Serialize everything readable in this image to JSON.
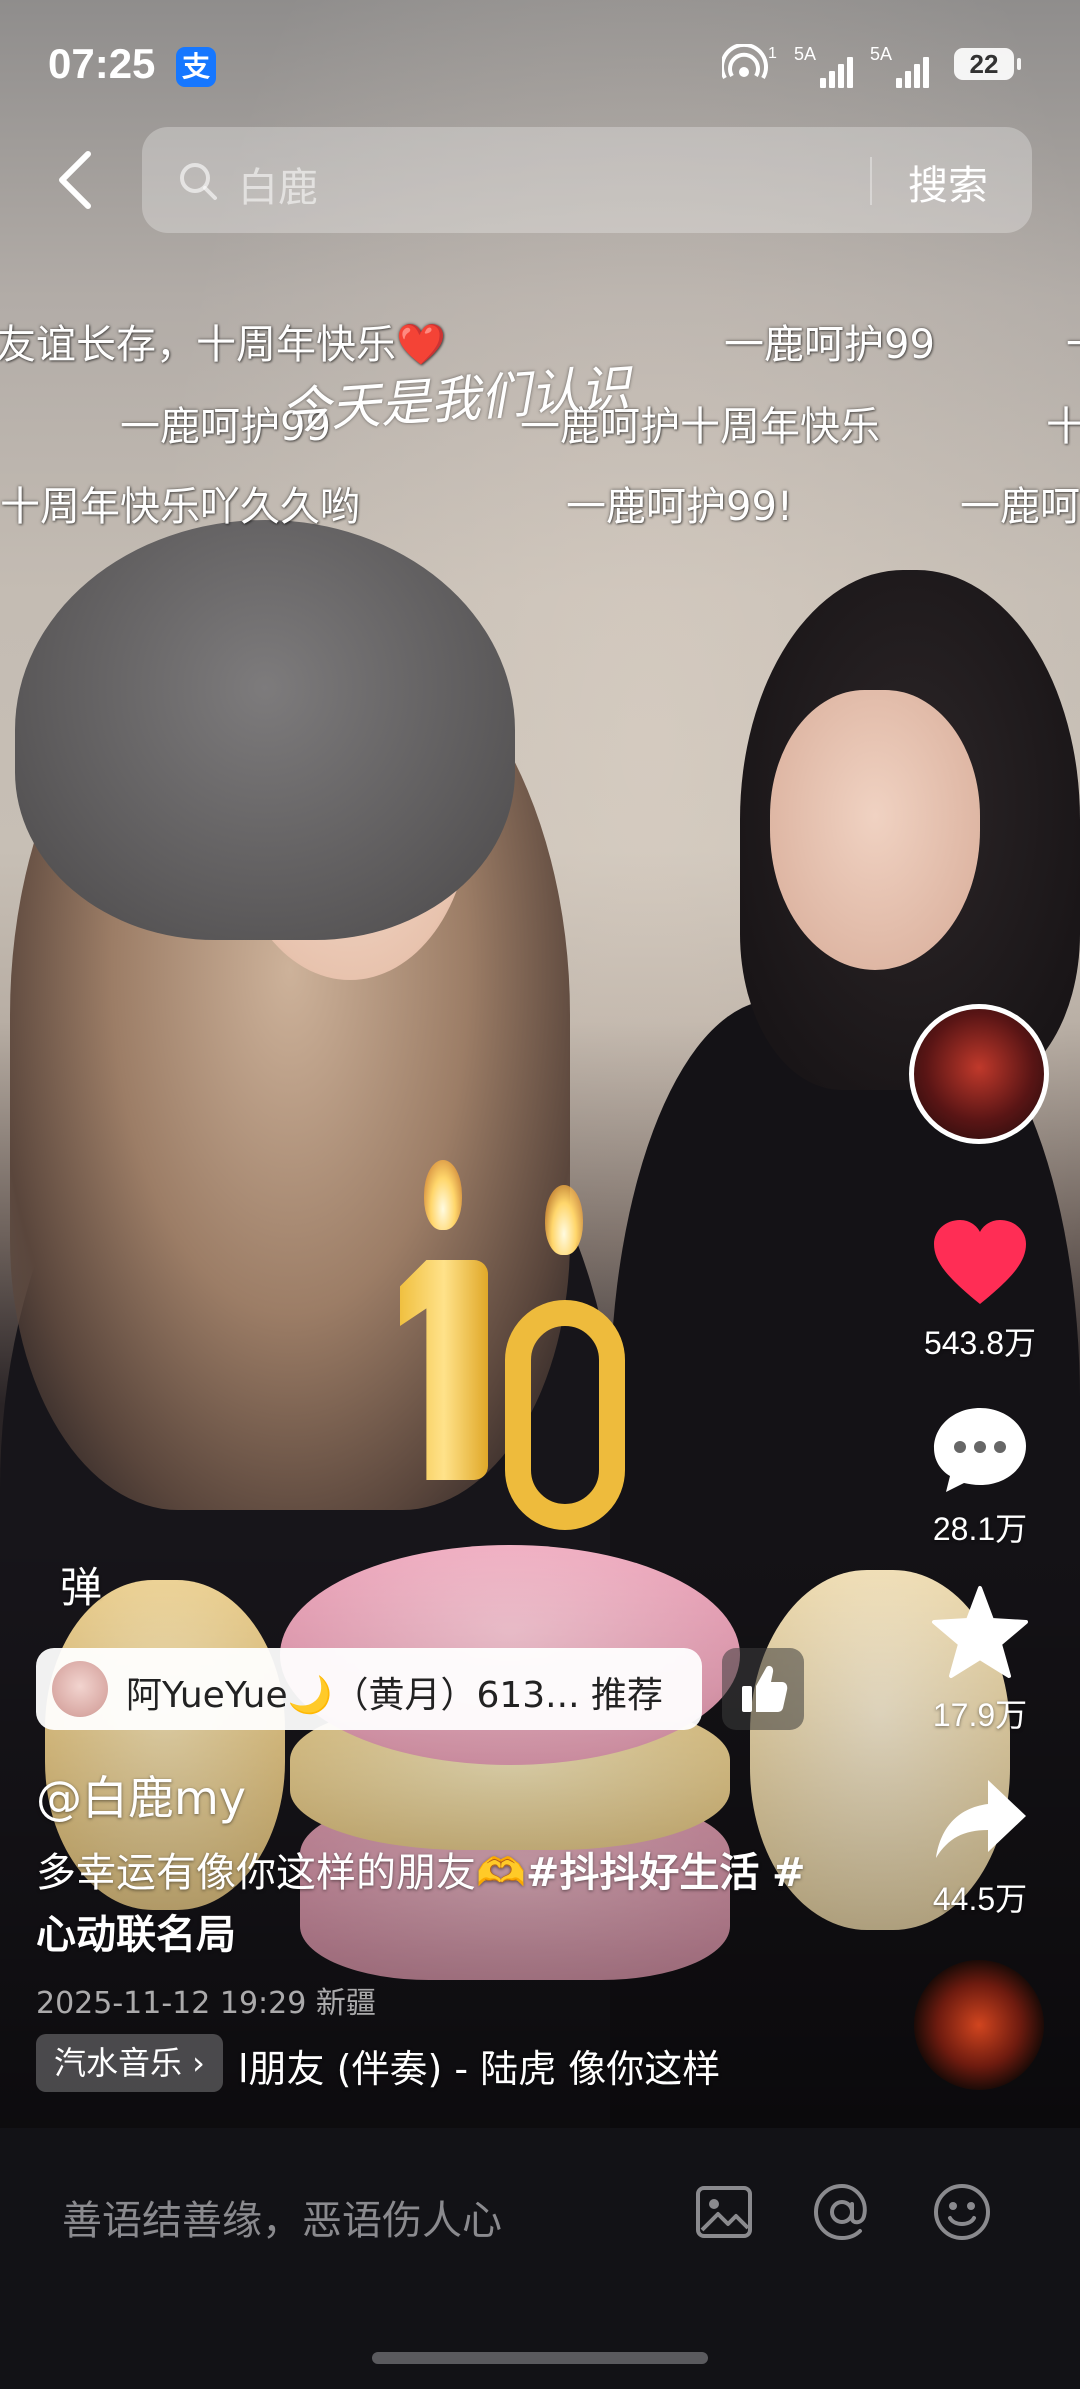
{
  "status_bar": {
    "time": "07:25",
    "alipay_glyph": "支",
    "hotspot_sub": "1",
    "sim1_label": "5A",
    "sim2_label": "5A",
    "battery": "22"
  },
  "search": {
    "query": "白鹿",
    "button_label": "搜索"
  },
  "danmaku": {
    "row1": [
      "友谊长存，十周年快乐❤️",
      "一鹿呵护99",
      "一"
    ],
    "row2": [
      "一鹿呵护99",
      "一鹿呵护十周年快乐",
      "十"
    ],
    "row3": [
      "十周年快乐吖久久哟",
      "一鹿呵护99!",
      "一鹿呵"
    ],
    "overlay": "今天是我们认识"
  },
  "actions": {
    "likes": "543.8万",
    "comments": "28.1万",
    "favorites": "17.9万",
    "shares": "44.5万"
  },
  "danmu_toggle": "弹",
  "recommend": {
    "text": "阿YueYue🌙（黄月）613... 推荐"
  },
  "post": {
    "author": "@白鹿my",
    "caption_plain": "多幸运有像你这样的朋友🫶",
    "tag1": "#抖抖好生活",
    "tag2": "#心动联名局",
    "meta": "2025-11-12 19:29 新疆"
  },
  "music": {
    "source": "汽水音乐 ›",
    "title": "l朋友 (伴奏) - 陆虎  像你这样"
  },
  "comment_bar": {
    "placeholder": "善语结善缘，恶语伤人心"
  },
  "icons": [
    "back-arrow-icon",
    "search-icon",
    "heart-icon",
    "comment-icon",
    "star-icon",
    "share-icon",
    "image-icon",
    "at-icon",
    "emoji-icon",
    "thumbs-up-icon"
  ],
  "colors": {
    "like_red": "#ff2d55",
    "alipay_blue": "#1677ff"
  }
}
